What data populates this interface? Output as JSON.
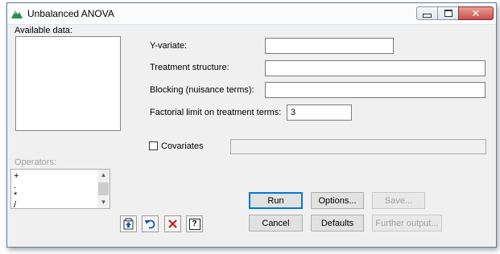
{
  "window": {
    "title": "Unbalanced ANOVA",
    "close_glyph": "✕"
  },
  "available_data": {
    "label": "Available data:"
  },
  "fields": {
    "y_variate": {
      "label": "Y-variate:",
      "value": ""
    },
    "treatment_structure": {
      "label": "Treatment structure:",
      "value": ""
    },
    "blocking": {
      "label": "Blocking (nuisance terms):",
      "value": ""
    },
    "factorial_limit": {
      "label": "Factorial limit on treatment terms:",
      "value": "3"
    },
    "covariates": {
      "label": "Covariates",
      "checked": false,
      "value": ""
    }
  },
  "operators": {
    "label": "Operators:",
    "items": [
      "+",
      ".",
      "*",
      "/"
    ]
  },
  "buttons": {
    "run": "Run",
    "options": "Options...",
    "save": "Save...",
    "cancel": "Cancel",
    "defaults": "Defaults",
    "further_output": "Further output..."
  },
  "toolbar": {
    "icons": [
      "transfer-icon",
      "undo-icon",
      "clear-icon",
      "help-icon"
    ],
    "help_glyph": "?"
  },
  "colors": {
    "accent": "#0078d7",
    "close_red": "#c75050",
    "clear_red": "#c02020",
    "undo_blue": "#1a4fb3"
  }
}
